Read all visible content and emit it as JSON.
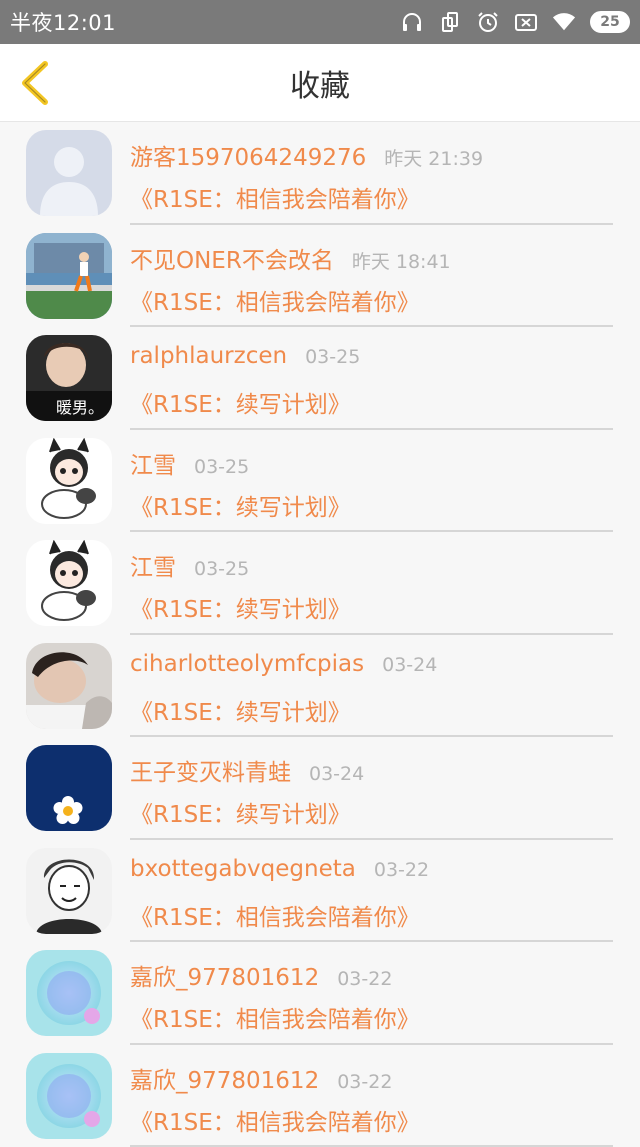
{
  "status_bar": {
    "time": "半夜12:01",
    "battery": "25"
  },
  "header": {
    "title": "收藏"
  },
  "colors": {
    "accent": "#f08a4b",
    "back_icon": "#f3c623",
    "status_bar": "#7a7a7a"
  },
  "items": [
    {
      "username": "游客1597064249276",
      "time": "昨天 21:39",
      "work": "《R1SE：相信我会陪着你》",
      "avatar": "default-avatar-icon"
    },
    {
      "username": "不见ONER不会改名",
      "time": "昨天 18:41",
      "work": "《R1SE：相信我会陪着你》",
      "avatar": "running-photo"
    },
    {
      "username": "ralphlaurzcen",
      "time": "03-25",
      "work": "《R1SE：续写计划》",
      "avatar": "portrait-photo",
      "avatar_caption": "暖男。"
    },
    {
      "username": "江雪",
      "time": "03-25",
      "work": "《R1SE：续写计划》",
      "avatar": "cat-girl-cartoon"
    },
    {
      "username": "江雪",
      "time": "03-25",
      "work": "《R1SE：续写计划》",
      "avatar": "cat-girl-cartoon"
    },
    {
      "username": "ciharlotteolymfcpias",
      "time": "03-24",
      "work": "《R1SE：续写计划》",
      "avatar": "sleeping-photo"
    },
    {
      "username": "王子变灭料青蛙",
      "time": "03-24",
      "work": "《R1SE：续写计划》",
      "avatar": "flower-on-navy"
    },
    {
      "username": "bxottegabvqegneta",
      "time": "03-22",
      "work": "《R1SE：相信我会陪着你》",
      "avatar": "manga-sketch"
    },
    {
      "username": "嘉欣_977801612",
      "time": "03-22",
      "work": "《R1SE：相信我会陪着你》",
      "avatar": "blue-bubble"
    },
    {
      "username": "嘉欣_977801612",
      "time": "03-22",
      "work": "《R1SE：相信我会陪着你》",
      "avatar": "blue-bubble"
    }
  ]
}
